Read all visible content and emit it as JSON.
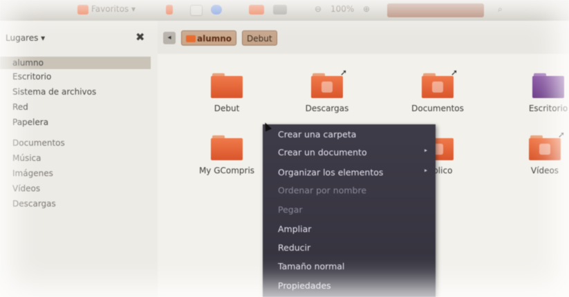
{
  "toolbar": {
    "items": [
      "Favoritos ▾",
      "100%"
    ]
  },
  "sidebar": {
    "header": "Lugares ▾",
    "close": "✖",
    "items": [
      {
        "label": "alumno",
        "selected": true
      },
      {
        "label": "Escritorio"
      },
      {
        "label": "Sistema de archivos"
      },
      {
        "label": "Red"
      },
      {
        "label": "Papelera"
      },
      {
        "label": "Documentos"
      },
      {
        "label": "Música"
      },
      {
        "label": "Imágenes"
      },
      {
        "label": "Vídeos"
      },
      {
        "label": "Descargas"
      }
    ]
  },
  "location": {
    "arrow": "◂",
    "buttons": [
      {
        "label": "alumno",
        "active": true
      },
      {
        "label": "Debut"
      }
    ]
  },
  "icons": [
    {
      "label": "Debut",
      "link": false
    },
    {
      "label": "Descargas",
      "link": true,
      "glyph": "download"
    },
    {
      "label": "Documentos",
      "link": true,
      "glyph": "document"
    },
    {
      "label": "Escritorio",
      "link": false,
      "color": "purple"
    },
    {
      "label": "My GCompris",
      "link": false
    },
    {
      "label": "Público",
      "link": false,
      "glyph": "person"
    },
    {
      "label": "Vídeos",
      "link": true,
      "glyph": "film"
    }
  ],
  "context_menu": {
    "items": [
      {
        "label": "Crear una carpeta",
        "enabled": true
      },
      {
        "label": "Crear un documento",
        "enabled": true,
        "submenu": true
      },
      {
        "label": "Organizar los elementos",
        "enabled": true,
        "submenu": true
      },
      {
        "label": "Ordenar por nombre",
        "enabled": false
      },
      {
        "label": "Pegar",
        "enabled": false
      },
      {
        "label": "Ampliar",
        "enabled": true
      },
      {
        "label": "Reducir",
        "enabled": true
      },
      {
        "label": "Tamaño normal",
        "enabled": true
      },
      {
        "label": "Propiedades",
        "enabled": true
      }
    ],
    "submenu_arrow": "▸"
  },
  "colors": {
    "folder_orange": "#e8683a",
    "menu_bg": "#3a3844",
    "selection": "#c9c3b8"
  }
}
